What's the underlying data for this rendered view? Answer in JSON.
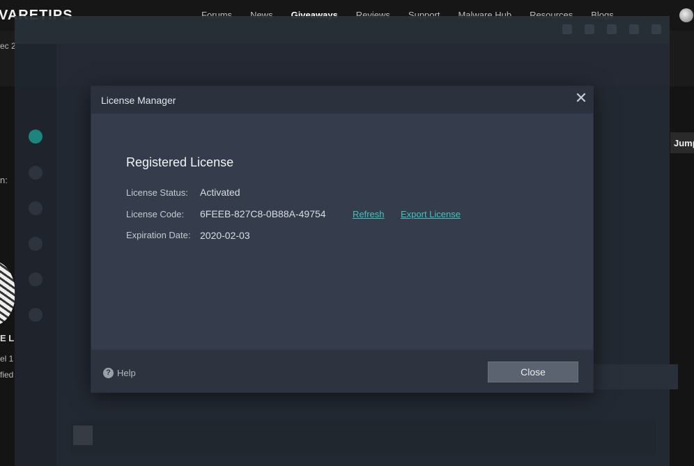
{
  "forum": {
    "logo": "VARETIPS",
    "menu": [
      {
        "label": "Forums"
      },
      {
        "label": "News"
      },
      {
        "label": "Giveaways"
      },
      {
        "label": "Reviews"
      },
      {
        "label": "Support"
      },
      {
        "label": "Malware Hub"
      },
      {
        "label": "Resources"
      },
      {
        "label": "Blogs"
      }
    ],
    "date_fragment": "ec 2",
    "jump_fragment": "Jump",
    "label_fragment": "n:",
    "user_name_fragment": "E L",
    "user_level_fragment": "el 1",
    "user_verified_fragment": "fied"
  },
  "dialog": {
    "title": "License Manager",
    "close_glyph": "✕",
    "heading": "Registered License",
    "fields": {
      "status": {
        "label": "License Status:",
        "value": "Activated"
      },
      "code": {
        "label": "License Code:",
        "value": "6FEEB-827C8-0B88A-49754"
      },
      "expiration": {
        "label": "Expiration Date:",
        "value": "2020-02-03"
      }
    },
    "links": {
      "refresh": "Refresh",
      "export": "Export License"
    },
    "footer": {
      "help_icon": "?",
      "help_label": "Help",
      "close_label": "Close"
    }
  },
  "colors": {
    "dialog_body": "#353d4d",
    "dialog_titlebar": "#2b323d",
    "link": "#3fc4bd",
    "close_button": "#5b6270",
    "accent_teal": "#1c8f86"
  }
}
